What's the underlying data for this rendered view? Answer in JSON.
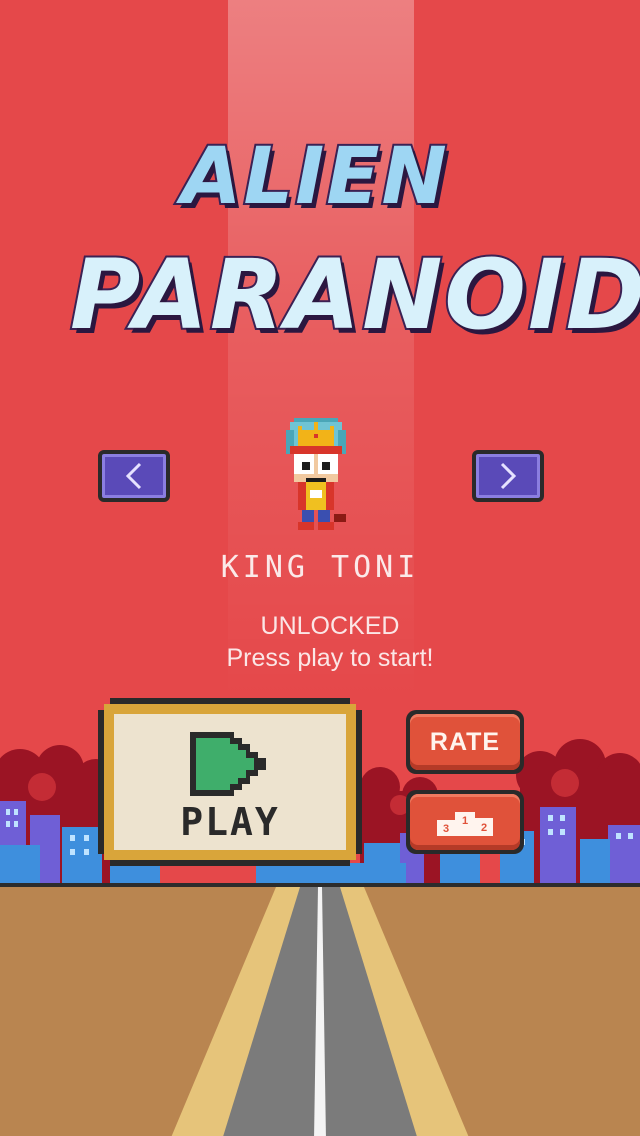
{
  "game": {
    "title_line1": "ALIEN",
    "title_line2": "PARANOID"
  },
  "character": {
    "name": "KING TONI",
    "status": "UNLOCKED",
    "hint": "Press play to start!"
  },
  "navigation": {
    "prev_icon": "chevron-left-icon",
    "next_icon": "chevron-right-icon"
  },
  "buttons": {
    "play_label": "PLAY",
    "play_icon": "play-triangle-icon",
    "rate_label": "RATE",
    "leaderboard_icon": "podium-icon",
    "podium_places": [
      "3",
      "1",
      "2"
    ]
  },
  "colors": {
    "background": "#e5484a",
    "arrow_button": "#5a4ab8",
    "play_triangle": "#3fae6b",
    "secondary_button": "#e0523a",
    "ground": "#b98550",
    "road": "#7b7b7b",
    "road_edge": "#e6c47a"
  }
}
